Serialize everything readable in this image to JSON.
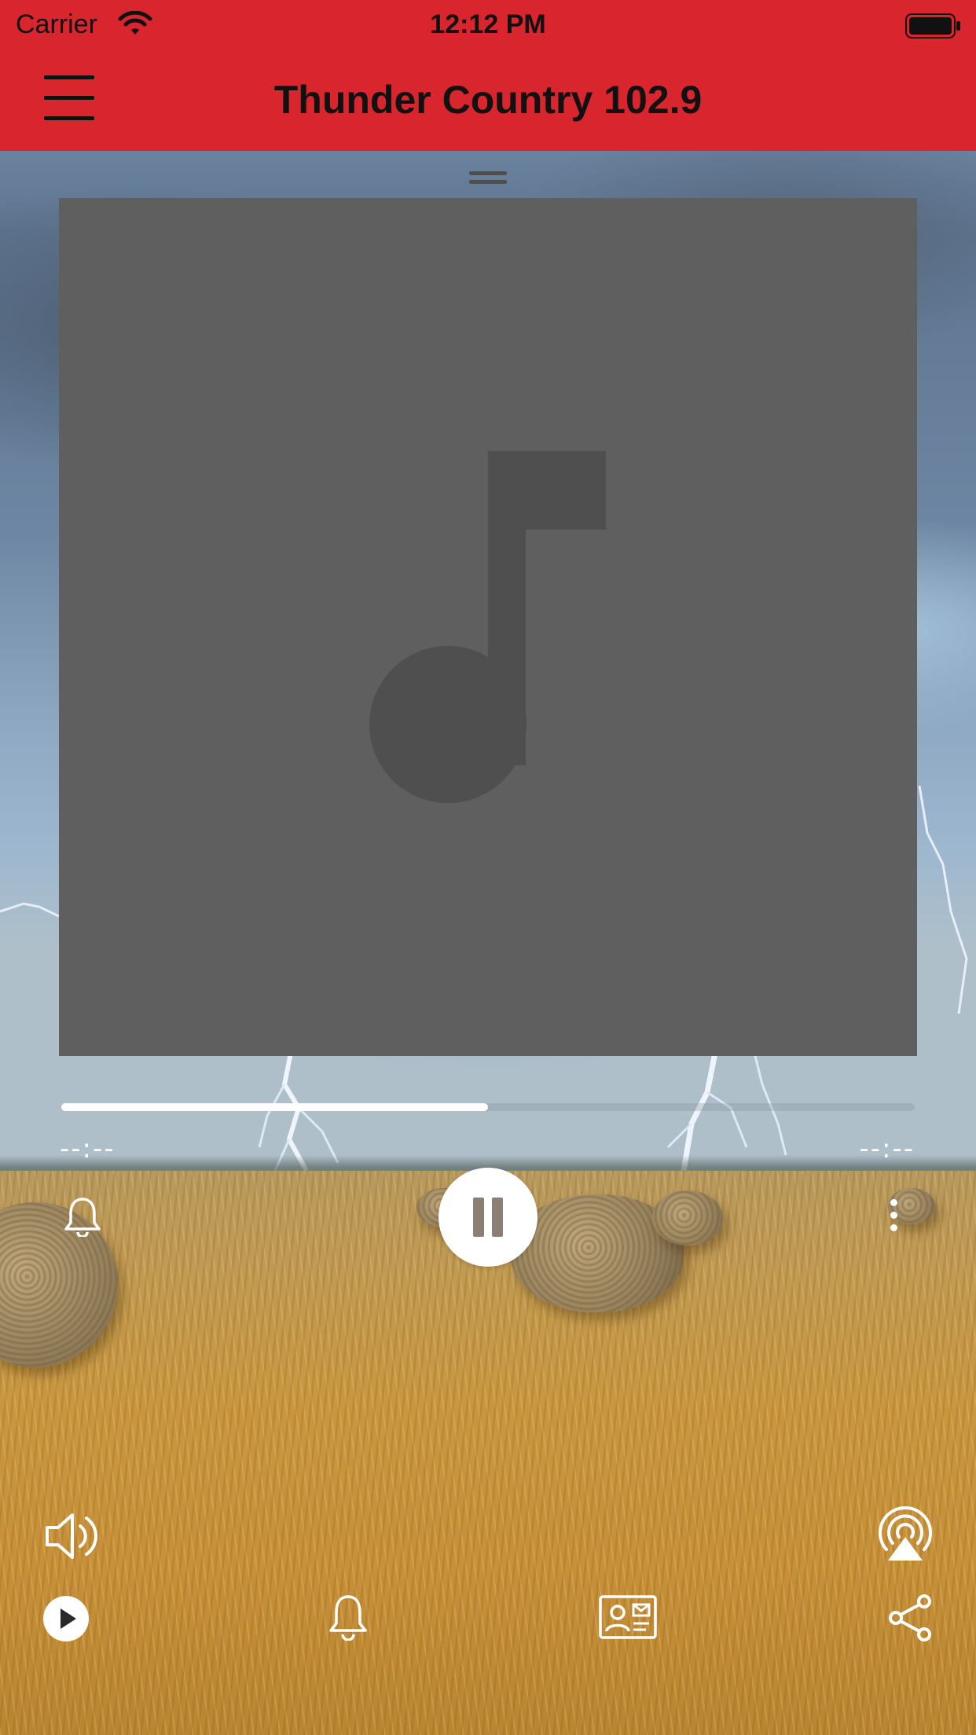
{
  "status_bar": {
    "carrier": "Carrier",
    "time": "12:12 PM",
    "icons": [
      "wifi-icon",
      "battery-icon"
    ]
  },
  "nav": {
    "title": "Thunder Country 102.9",
    "menu_icon": "hamburger-menu-icon"
  },
  "colors": {
    "accent": "#d9252d",
    "artwork_placeholder": "#5f5f5f",
    "artwork_glyph": "#4f4f4f",
    "control_white": "#ffffff"
  },
  "player": {
    "artwork_icon": "music-note-icon",
    "progress_fraction": 0.5,
    "time_elapsed": "--:--",
    "time_remaining": "--:--",
    "state": "playing",
    "controls": [
      "alarm-bell-icon",
      "pause-icon",
      "more-vertical-icon"
    ]
  },
  "bottom": {
    "volume_icon": "speaker-volume-icon",
    "airplay_icon": "airplay-icon",
    "toolbar": [
      "play-circle-icon",
      "bell-icon",
      "contact-card-icon",
      "share-icon"
    ]
  }
}
